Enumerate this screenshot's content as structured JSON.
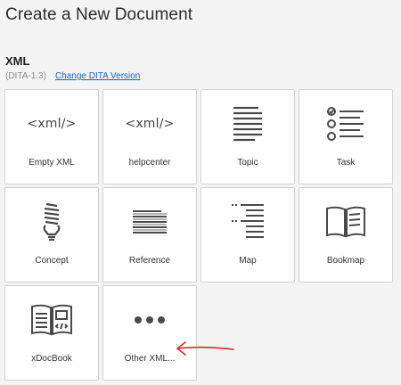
{
  "page_title": "Create a New Document",
  "section": {
    "title": "XML",
    "version": "(DITA-1.3)",
    "change_link": "Change DITA Version"
  },
  "icons": {
    "xml_text": "<xml/>"
  },
  "templates": [
    {
      "label": "Empty XML",
      "icon": "xml-icon"
    },
    {
      "label": "helpcenter",
      "icon": "xml-icon"
    },
    {
      "label": "Topic",
      "icon": "text-lines-icon"
    },
    {
      "label": "Task",
      "icon": "checklist-icon"
    },
    {
      "label": "Concept",
      "icon": "lightbulb-icon"
    },
    {
      "label": "Reference",
      "icon": "reference-lines-icon"
    },
    {
      "label": "Map",
      "icon": "map-tree-icon"
    },
    {
      "label": "Bookmap",
      "icon": "book-icon"
    },
    {
      "label": "xDocBook",
      "icon": "docbook-icon"
    },
    {
      "label": "Other XML...",
      "icon": "more-dots-icon"
    }
  ],
  "colors": {
    "link": "#1f5ec8",
    "icon": "#4a4a4a",
    "annotation_arrow": "#d62b2b"
  }
}
